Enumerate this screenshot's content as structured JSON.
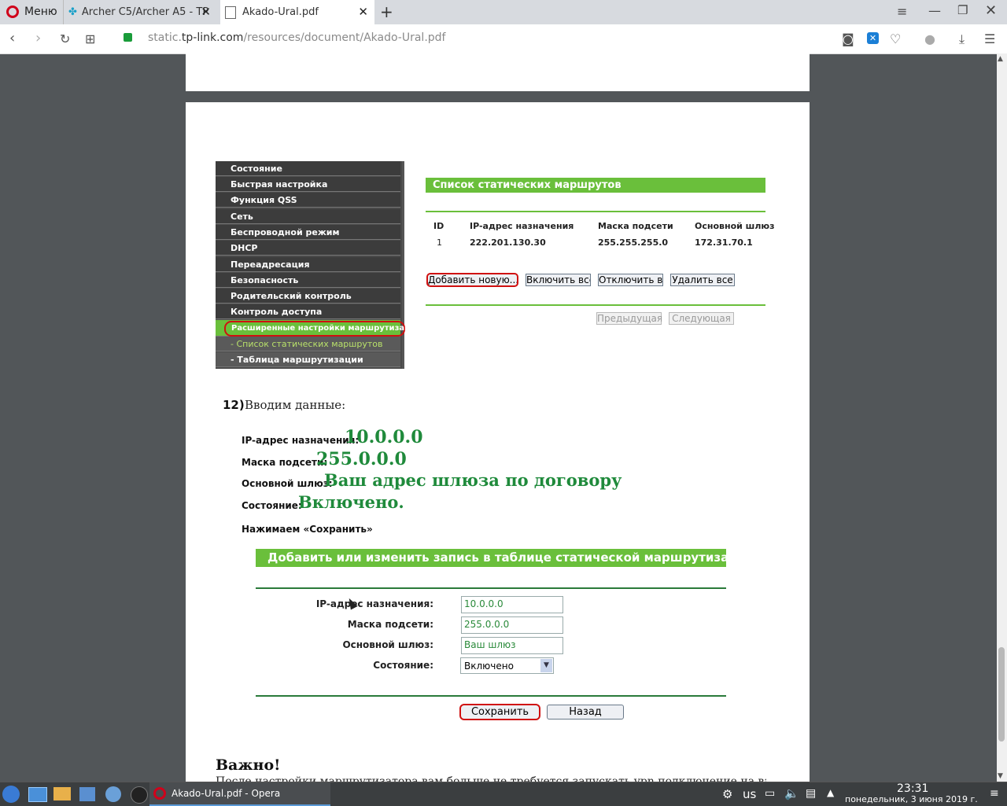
{
  "browser": {
    "menu_label": "Меню",
    "tabs": [
      {
        "title": "Archer C5/Archer A5 - TP"
      },
      {
        "title": "Akado-Ural.pdf"
      }
    ],
    "url_prefix": "static.",
    "url_domain": "tp-link.com",
    "url_path": "/resources/document/Akado-Ural.pdf"
  },
  "router1": {
    "nav": [
      "Состояние",
      "Быстрая настройка",
      "Функция QSS",
      "Сеть",
      "Беспроводной режим",
      "DHCP",
      "Переадресация",
      "Безопасность",
      "Родительский контроль",
      "Контроль доступа"
    ],
    "nav_active": "Расширенные настройки маршрутизации",
    "sub_active": "- Список статических маршрутов",
    "sub_other": "- Таблица маршрутизации",
    "title": "Список статических маршрутов",
    "headers": [
      "ID",
      "IP-адрес назначения",
      "Маска подсети",
      "Основной шлюз"
    ],
    "row": [
      "1",
      "222.201.130.30",
      "255.255.255.0",
      "172.31.70.1"
    ],
    "buttons": [
      "Добавить новую...",
      "Включить все",
      "Отключить вс",
      "Удалить все"
    ],
    "prev": "Предыдущая",
    "next": "Следующая"
  },
  "step": {
    "number": "12)",
    "text": "Вводим данные:",
    "lines": [
      {
        "label": "IP-адрес назначения:",
        "value": "10.0.0.0"
      },
      {
        "label": "Маска подсети:",
        "value": "255.0.0.0"
      },
      {
        "label": "Основной шлюз:",
        "value": "Ваш адрес шлюза по договору"
      },
      {
        "label": "Состояние:",
        "value": "Включено."
      }
    ],
    "save_note": "Нажимаем «Сохранить»"
  },
  "router2": {
    "title": "Добавить или изменить запись в таблице статической маршрутизации",
    "fields": [
      {
        "label": "IP-адрес назначения:",
        "value": "10.0.0.0"
      },
      {
        "label": "Маска подсети:",
        "value": "255.0.0.0"
      },
      {
        "label": "Основной шлюз:",
        "value": "Ваш шлюз"
      }
    ],
    "status_label": "Состояние:",
    "status_value": "Включено",
    "save": "Сохранить",
    "back": "Назад"
  },
  "important": "Важно!",
  "cut_text": "После настройки маршрутизатора вам больше не требуется запускать vpn подключение на вашем",
  "taskbar": {
    "app": "Akado-Ural.pdf - Opera",
    "lang": "us",
    "time": "23:31",
    "date": "понедельник, 3 июня 2019 г."
  },
  "colors": {
    "green_bar": "#6abf3b",
    "value_green": "#1f8a3b",
    "highlight_red": "#d01010"
  }
}
